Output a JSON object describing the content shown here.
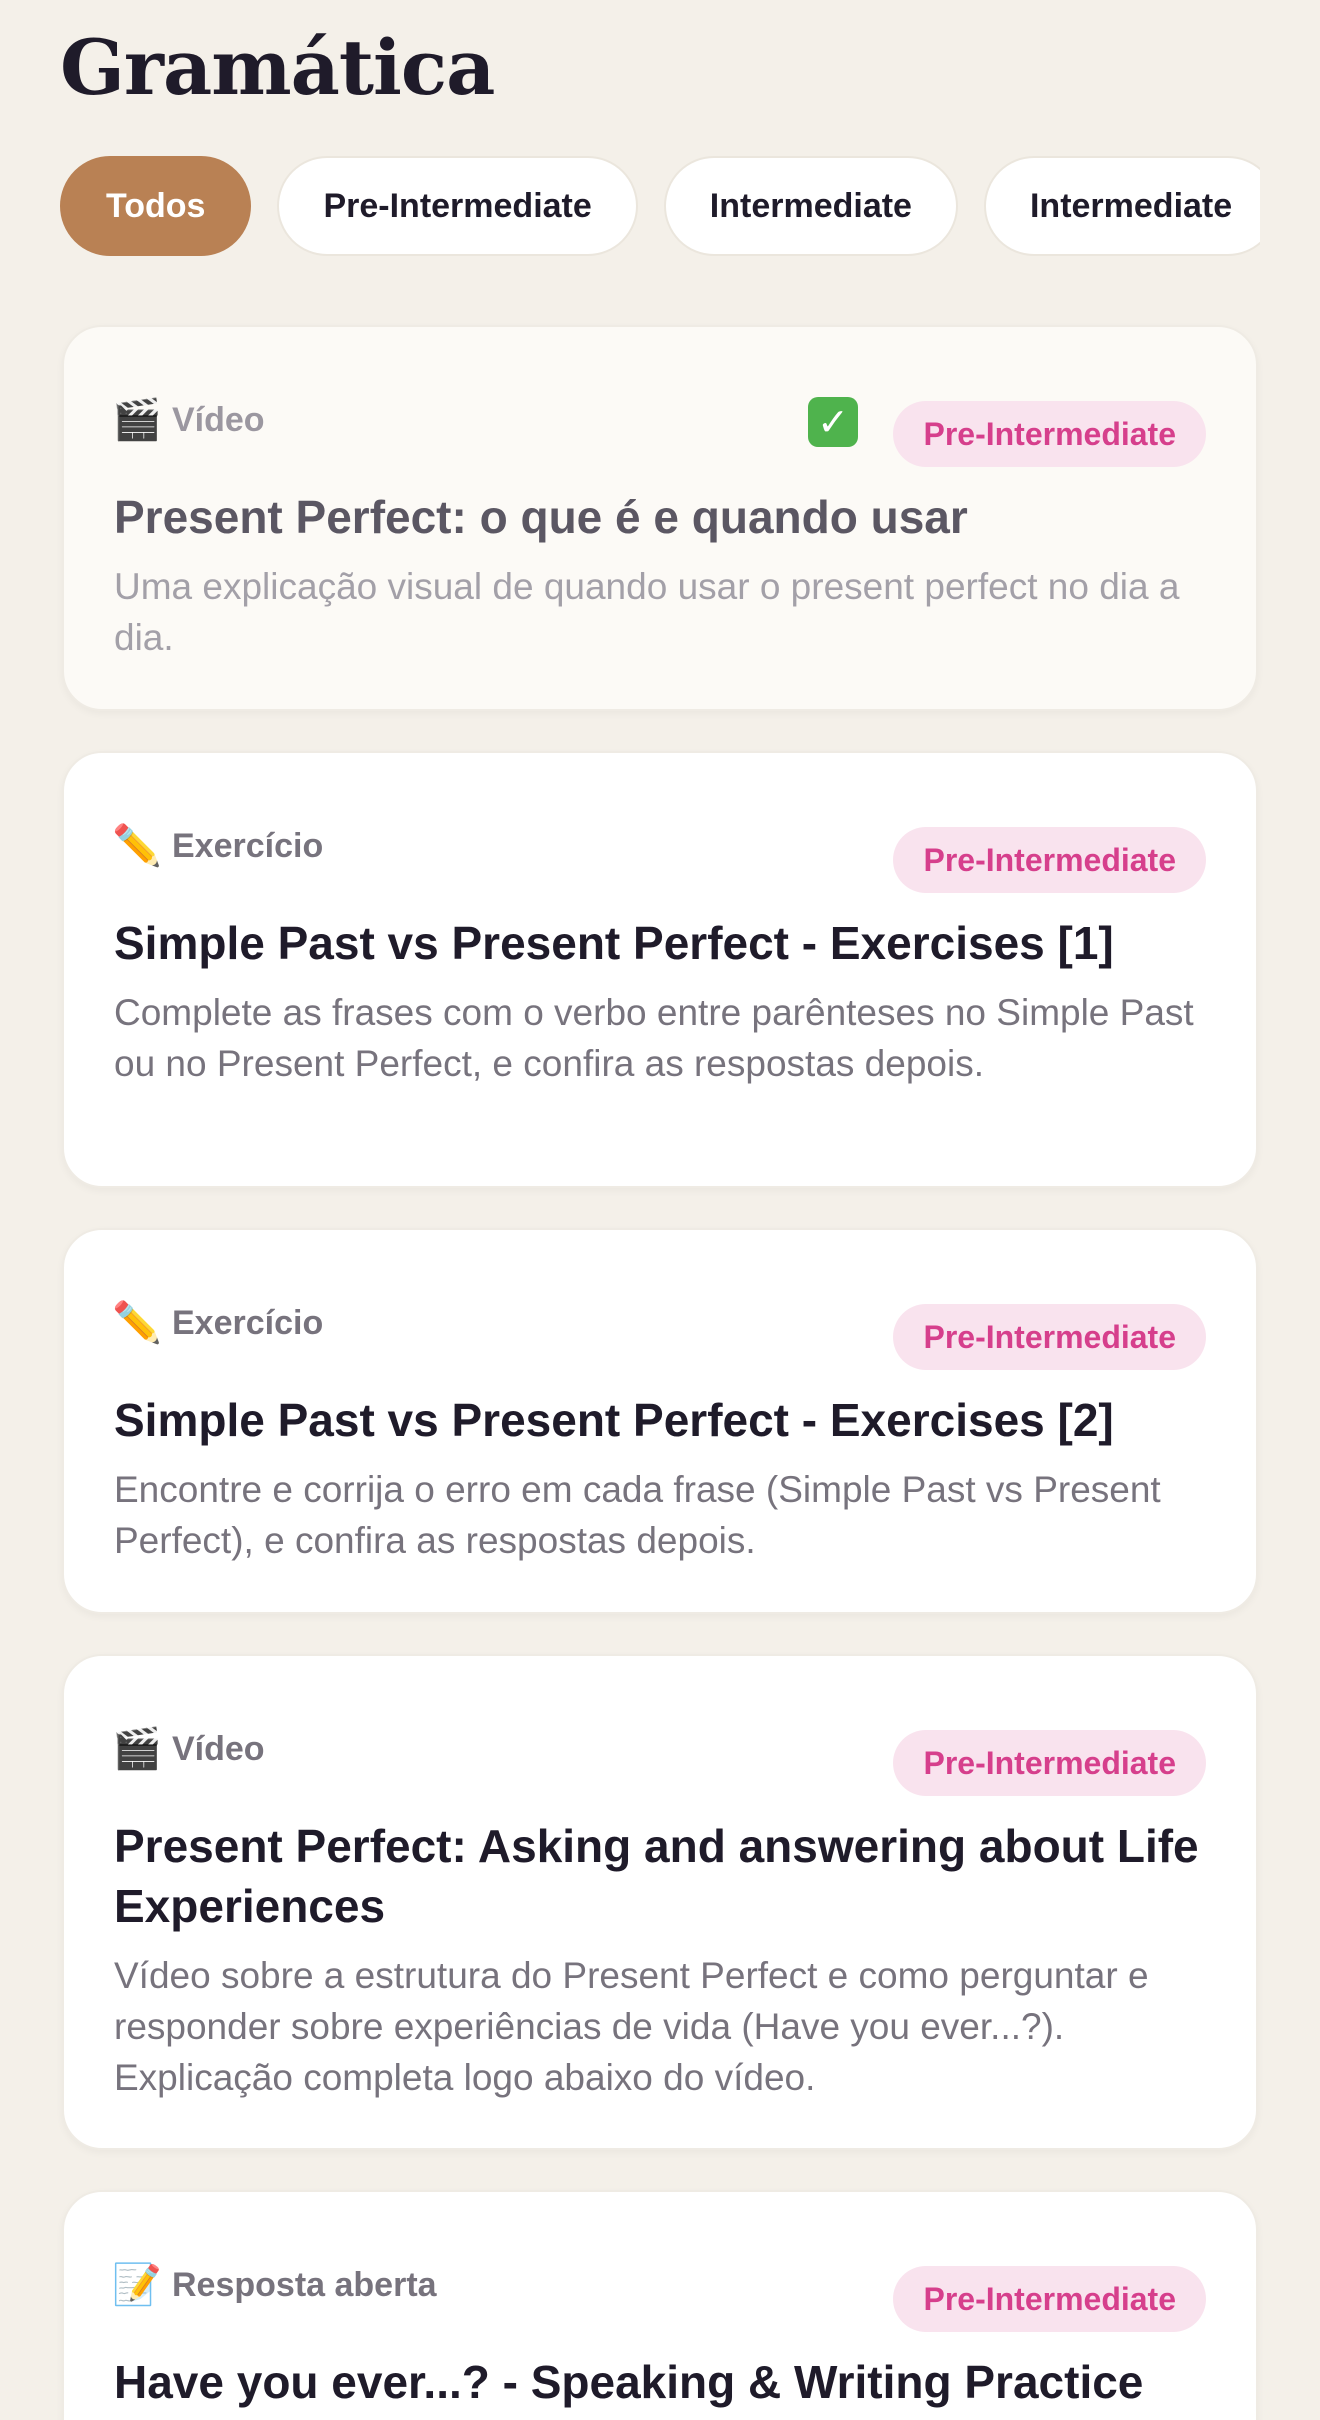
{
  "header": {
    "title": "Gramática"
  },
  "filters": [
    {
      "label": "Todos",
      "active": true
    },
    {
      "label": "Pre-Intermediate",
      "active": false
    },
    {
      "label": "Intermediate",
      "active": false
    },
    {
      "label": "Intermediate",
      "active": false
    }
  ],
  "cards": [
    {
      "type_icon": "clapperboard-icon",
      "type_label": "Vídeo",
      "completed": true,
      "level": "Pre-Intermediate",
      "title": "Present Perfect: o que é e quando usar",
      "description": "Uma explicação visual de quando usar o present perfect no dia a dia."
    },
    {
      "type_icon": "pencil-icon",
      "type_label": "Exercício",
      "completed": false,
      "level": "Pre-Intermediate",
      "title": "Simple Past vs Present Perfect - Exercises [1]",
      "description": "Complete as frases com o verbo entre parênteses no Simple Past ou no Present Perfect, e confira as respostas depois."
    },
    {
      "type_icon": "pencil-icon",
      "type_label": "Exercício",
      "completed": false,
      "level": "Pre-Intermediate",
      "title": "Simple Past vs Present Perfect - Exercises [2]",
      "description": "Encontre e corrija o erro em cada frase (Simple Past vs Present Perfect), e confira as respostas depois."
    },
    {
      "type_icon": "clapperboard-icon",
      "type_label": "Vídeo",
      "completed": false,
      "level": "Pre-Intermediate",
      "title": "Present Perfect: Asking and answering about Life Experiences",
      "description": "Vídeo sobre a estrutura do Present Perfect e como perguntar e responder sobre experiências de vida (Have you ever...?). Explicação completa logo abaixo do vídeo."
    },
    {
      "type_icon": "memo-icon",
      "type_label": "Resposta aberta",
      "completed": false,
      "level": "Pre-Intermediate",
      "title": "Have you ever...? - Speaking & Writing Practice",
      "description": ""
    }
  ],
  "colors": {
    "background": "#f4f0e9",
    "accent": "#b98154",
    "badge_text": "#d63f8c",
    "badge_bg": "#f9e3ee",
    "completed_check": "#4fb34d"
  }
}
